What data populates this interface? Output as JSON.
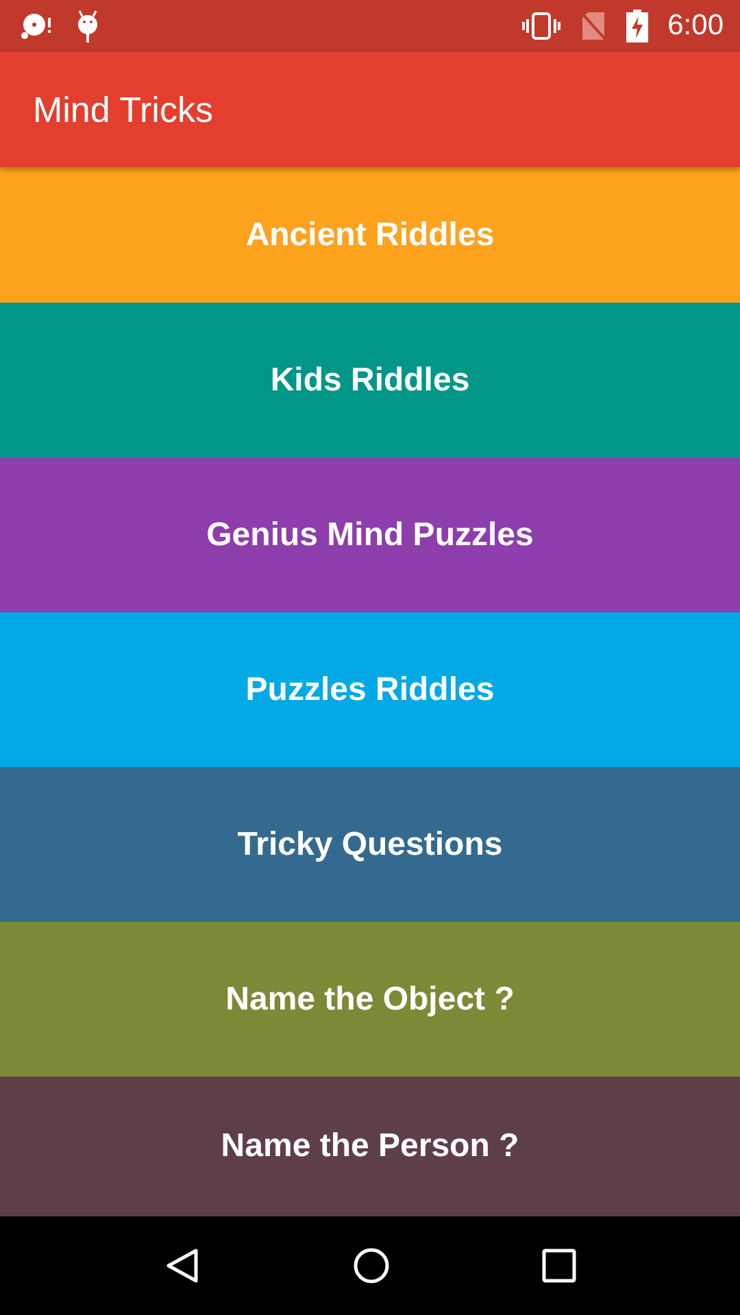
{
  "status_bar": {
    "time": "6:00"
  },
  "app_bar": {
    "title": "Mind Tricks"
  },
  "categories": [
    {
      "label": "Ancient Riddles",
      "color": "#ffa21e"
    },
    {
      "label": "Kids Riddles",
      "color": "#009688"
    },
    {
      "label": "Genius Mind Puzzles",
      "color": "#8e3dac"
    },
    {
      "label": "Puzzles Riddles",
      "color": "#03a9e4"
    },
    {
      "label": "Tricky Questions",
      "color": "#356a90"
    },
    {
      "label": "Name the Object ?",
      "color": "#7b8a37"
    },
    {
      "label": "Name the Person ?",
      "color": "#5e3f48"
    }
  ]
}
